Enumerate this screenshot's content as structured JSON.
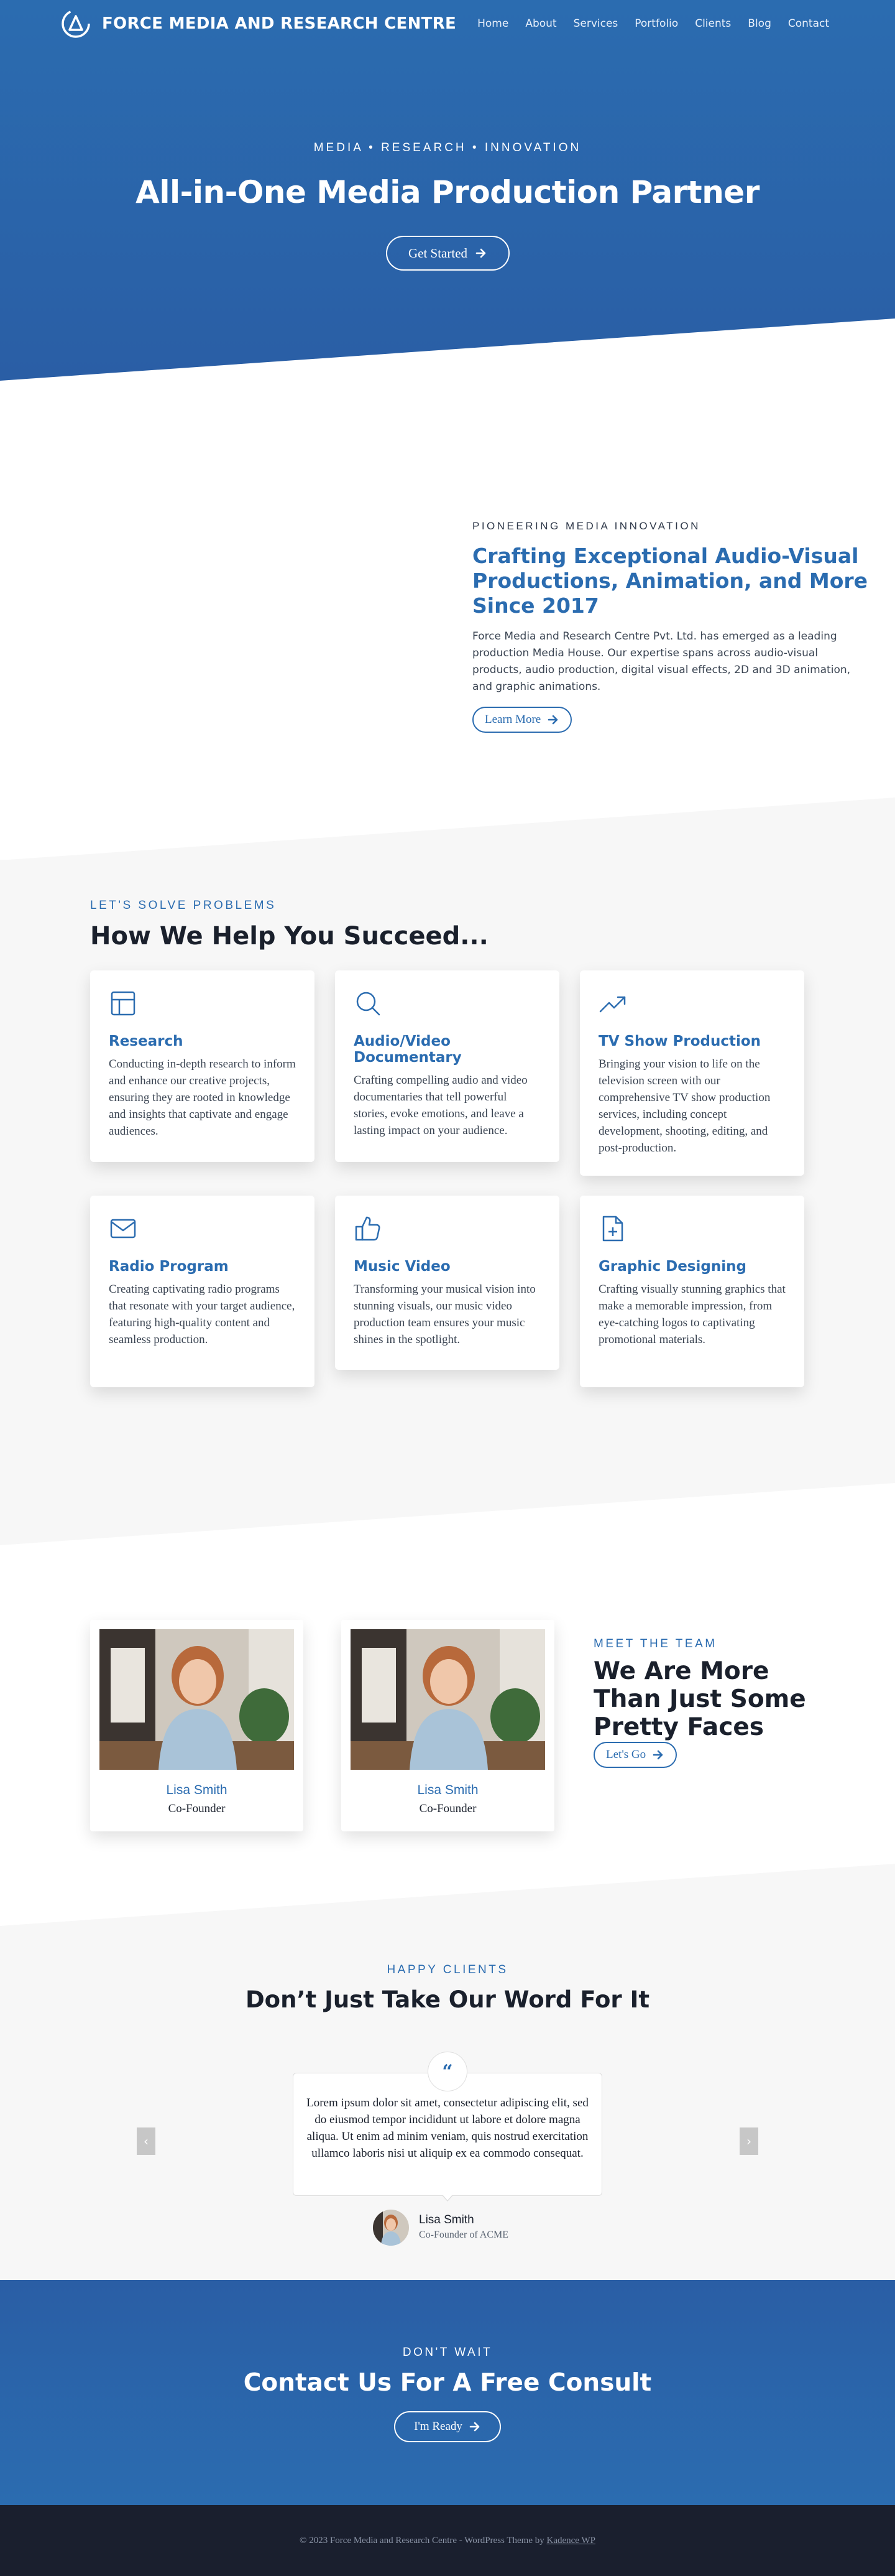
{
  "header": {
    "brand": "FORCE MEDIA AND RESEARCH CENTRE",
    "nav": [
      "Home",
      "About",
      "Services",
      "Portfolio",
      "Clients",
      "Blog",
      "Contact"
    ]
  },
  "hero": {
    "kicker": "MEDIA • RESEARCH • INNOVATION",
    "title": "All-in-One Media Production Partner",
    "button": "Get Started"
  },
  "about": {
    "kicker": "PIONEERING MEDIA INNOVATION",
    "heading": "Crafting Exceptional Audio-Visual Productions, Animation, and More Since 2017",
    "body": "Force Media and Research Centre Pvt. Ltd. has emerged as a leading production Media House. Our expertise spans across audio-visual products, audio production, digital visual effects, 2D and 3D animation, and graphic animations.",
    "button": "Learn More"
  },
  "services": {
    "kicker": "LET'S SOLVE PROBLEMS",
    "heading": "How We Help You Succeed...",
    "cards": [
      {
        "icon": "layout-icon",
        "title": "Research",
        "desc": "Conducting in-depth research to inform and enhance our creative projects, ensuring they are rooted in knowledge and insights that captivate and engage audiences."
      },
      {
        "icon": "search-icon",
        "title": "Audio/Video Documentary",
        "desc": "Crafting compelling audio and video documentaries that tell powerful stories, evoke emotions, and leave a lasting impact on your audience."
      },
      {
        "icon": "trending-up-icon",
        "title": "TV Show Production",
        "desc": "Bringing your vision to life on the television screen with our comprehensive TV show production services, including concept development, shooting, editing, and post-production."
      },
      {
        "icon": "mail-icon",
        "title": "Radio Program",
        "desc": "Creating captivating radio programs that resonate with your target audience, featuring high-quality content and seamless production."
      },
      {
        "icon": "thumbs-up-icon",
        "title": "Music Video",
        "desc": "Transforming your musical vision into stunning visuals, our music video production team ensures your music shines in the spotlight."
      },
      {
        "icon": "file-plus-icon",
        "title": "Graphic Designing",
        "desc": "Crafting visually stunning graphics that make a memorable impression, from eye-catching logos to captivating promotional materials."
      }
    ]
  },
  "team": {
    "members": [
      {
        "name": "Lisa Smith",
        "role": "Co-Founder"
      },
      {
        "name": "Lisa Smith",
        "role": "Co-Founder"
      }
    ],
    "kicker": "MEET THE TEAM",
    "heading": "We Are More Than Just Some Pretty Faces",
    "button": "Let's Go"
  },
  "testimonials": {
    "kicker": "HAPPY CLIENTS",
    "heading": "Don’t Just Take Our Word For It",
    "quote": "Lorem ipsum dolor sit amet, consectetur adipiscing elit, sed do eiusmod tempor incididunt ut labore et dolore magna aliqua. Ut enim ad minim veniam, quis nostrud exercitation ullamco laboris nisi ut aliquip ex ea commodo consequat.",
    "quote_mark": "“",
    "author": "Lisa Smith",
    "author_title": "Co-Founder of ACME",
    "prev": "‹",
    "next": "›"
  },
  "cta": {
    "kicker": "DON'T WAIT",
    "heading": "Contact Us For A Free Consult",
    "button": "I'm Ready"
  },
  "footer": {
    "text": "© 2023 Force Media and Research Centre - WordPress Theme by ",
    "link": "Kadence WP"
  },
  "colors": {
    "primary": "#2b6cb0",
    "section_bg": "#f7f7f7",
    "footer_bg": "#1a1f2e"
  }
}
